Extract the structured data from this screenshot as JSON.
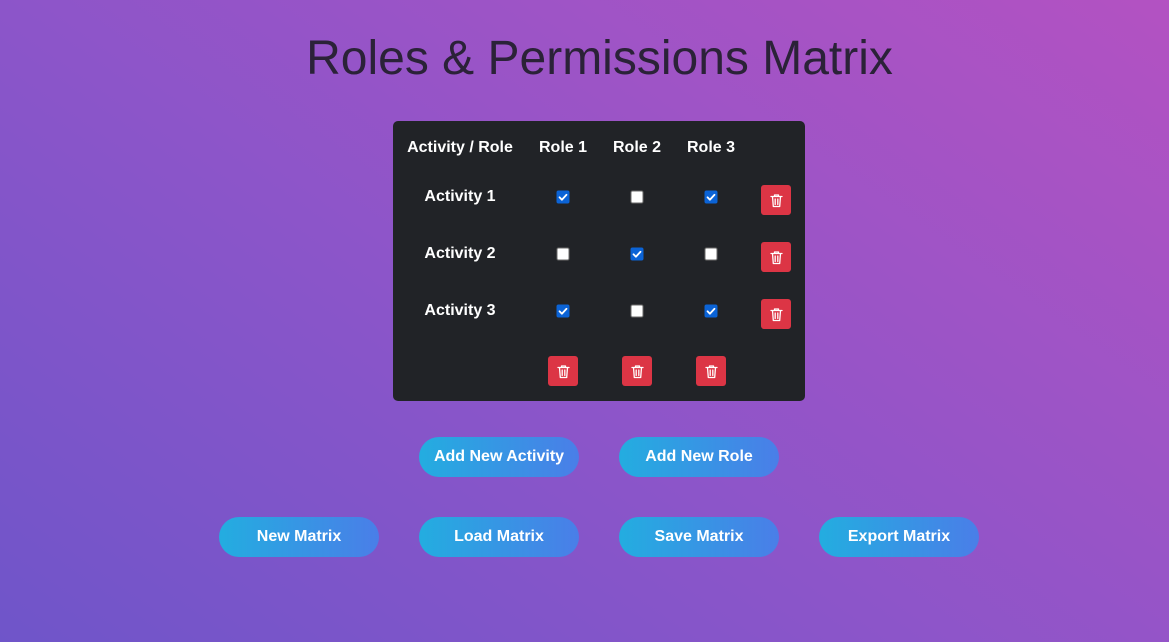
{
  "page": {
    "title": "Roles & Permissions Matrix"
  },
  "matrix": {
    "corner_label": "Activity / Role",
    "roles": [
      "Role 1",
      "Role 2",
      "Role 3"
    ],
    "activities": [
      {
        "name": "Activity 1",
        "permissions": [
          true,
          false,
          true
        ]
      },
      {
        "name": "Activity 2",
        "permissions": [
          false,
          true,
          false
        ]
      },
      {
        "name": "Activity 3",
        "permissions": [
          true,
          false,
          true
        ]
      }
    ],
    "delete_icon": "trash-icon"
  },
  "actions": {
    "add_activity_label": "Add New Activity",
    "add_role_label": "Add New Role"
  },
  "file_actions": {
    "new_label": "New Matrix",
    "load_label": "Load Matrix",
    "save_label": "Save Matrix",
    "export_label": "Export Matrix"
  },
  "colors": {
    "background_start": "#6f55c9",
    "background_end": "#b352c2",
    "card": "#212327",
    "delete_button": "#dc3545",
    "checkbox_checked": "#0b63d6",
    "button_gradient_start": "#23ade0",
    "button_gradient_end": "#4a7ee8"
  }
}
